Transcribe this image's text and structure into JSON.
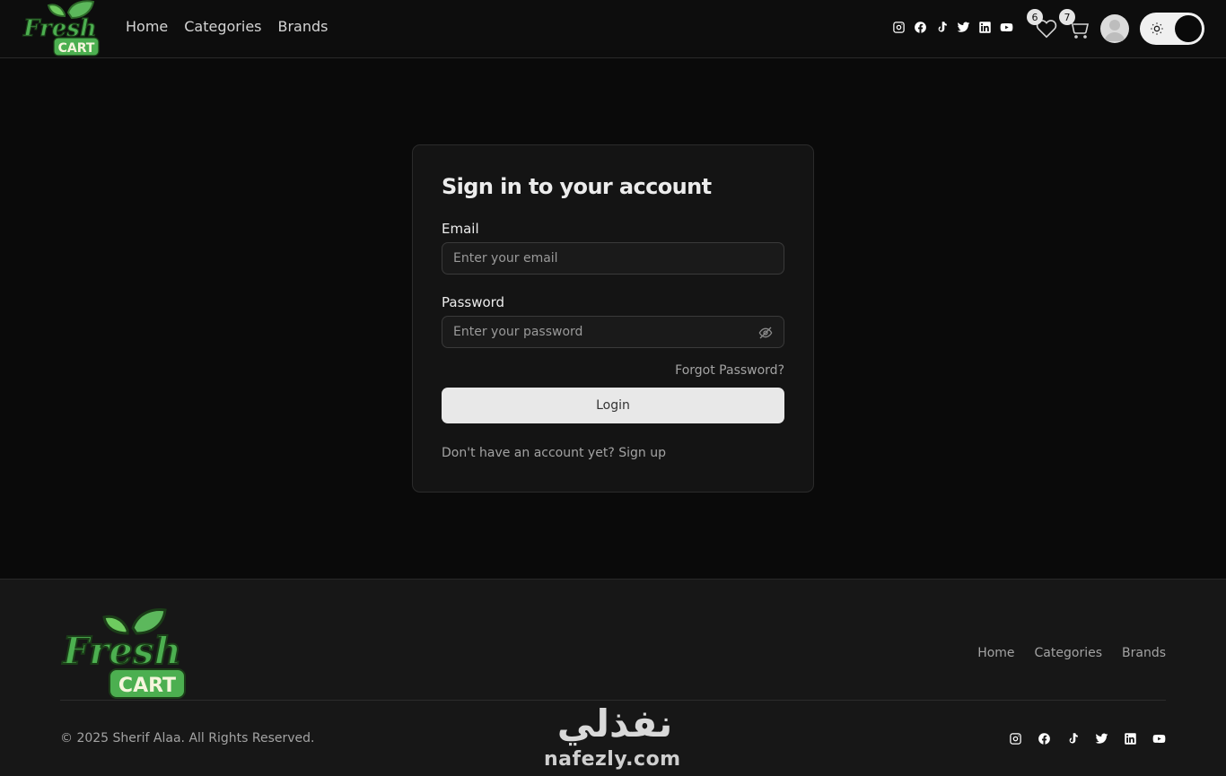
{
  "brand": {
    "logo_word1": "Fresh",
    "logo_word2": "CART",
    "leaf_color": "#4caf50",
    "logo_green": "#3d8b37"
  },
  "nav": {
    "links": [
      "Home",
      "Categories",
      "Brands"
    ],
    "social": [
      "instagram-icon",
      "facebook-icon",
      "tiktok-icon",
      "twitter-icon",
      "linkedin-icon",
      "youtube-icon"
    ],
    "wishlist_count": "6",
    "cart_count": "7"
  },
  "login": {
    "title": "Sign in to your account",
    "email_label": "Email",
    "email_placeholder": "Enter your email",
    "password_label": "Password",
    "password_placeholder": "Enter your password",
    "forgot": "Forgot Password?",
    "login_button": "Login",
    "signup_prompt": "Don't have an account yet?",
    "signup_link": "Sign up"
  },
  "footer": {
    "links": [
      "Home",
      "Categories",
      "Brands"
    ],
    "copyright": "© 2025 Sherif Alaa. All Rights Reserved.",
    "watermark_arabic": "نفذلي",
    "watermark_latin": "nafezly.com"
  }
}
